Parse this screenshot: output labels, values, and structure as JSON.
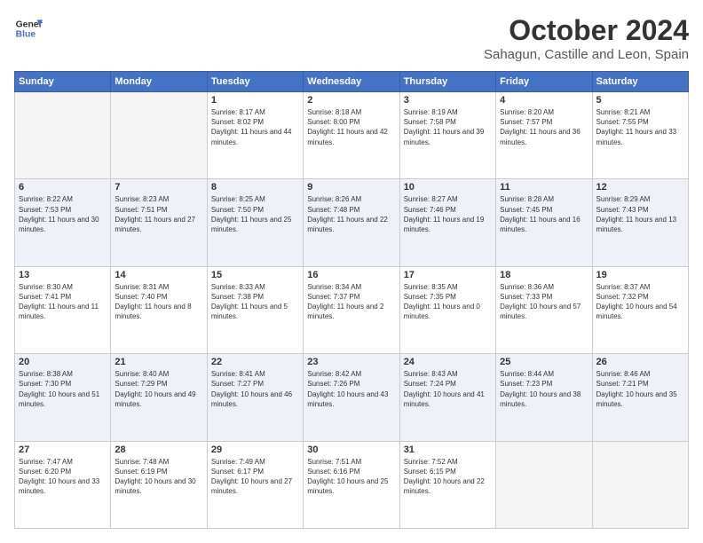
{
  "header": {
    "logo_line1": "General",
    "logo_line2": "Blue",
    "month": "October 2024",
    "location": "Sahagun, Castille and Leon, Spain"
  },
  "weekdays": [
    "Sunday",
    "Monday",
    "Tuesday",
    "Wednesday",
    "Thursday",
    "Friday",
    "Saturday"
  ],
  "weeks": [
    [
      {
        "day": "",
        "content": ""
      },
      {
        "day": "",
        "content": ""
      },
      {
        "day": "1",
        "content": "Sunrise: 8:17 AM\nSunset: 8:02 PM\nDaylight: 11 hours and 44 minutes."
      },
      {
        "day": "2",
        "content": "Sunrise: 8:18 AM\nSunset: 8:00 PM\nDaylight: 11 hours and 42 minutes."
      },
      {
        "day": "3",
        "content": "Sunrise: 8:19 AM\nSunset: 7:58 PM\nDaylight: 11 hours and 39 minutes."
      },
      {
        "day": "4",
        "content": "Sunrise: 8:20 AM\nSunset: 7:57 PM\nDaylight: 11 hours and 36 minutes."
      },
      {
        "day": "5",
        "content": "Sunrise: 8:21 AM\nSunset: 7:55 PM\nDaylight: 11 hours and 33 minutes."
      }
    ],
    [
      {
        "day": "6",
        "content": "Sunrise: 8:22 AM\nSunset: 7:53 PM\nDaylight: 11 hours and 30 minutes."
      },
      {
        "day": "7",
        "content": "Sunrise: 8:23 AM\nSunset: 7:51 PM\nDaylight: 11 hours and 27 minutes."
      },
      {
        "day": "8",
        "content": "Sunrise: 8:25 AM\nSunset: 7:50 PM\nDaylight: 11 hours and 25 minutes."
      },
      {
        "day": "9",
        "content": "Sunrise: 8:26 AM\nSunset: 7:48 PM\nDaylight: 11 hours and 22 minutes."
      },
      {
        "day": "10",
        "content": "Sunrise: 8:27 AM\nSunset: 7:46 PM\nDaylight: 11 hours and 19 minutes."
      },
      {
        "day": "11",
        "content": "Sunrise: 8:28 AM\nSunset: 7:45 PM\nDaylight: 11 hours and 16 minutes."
      },
      {
        "day": "12",
        "content": "Sunrise: 8:29 AM\nSunset: 7:43 PM\nDaylight: 11 hours and 13 minutes."
      }
    ],
    [
      {
        "day": "13",
        "content": "Sunrise: 8:30 AM\nSunset: 7:41 PM\nDaylight: 11 hours and 11 minutes."
      },
      {
        "day": "14",
        "content": "Sunrise: 8:31 AM\nSunset: 7:40 PM\nDaylight: 11 hours and 8 minutes."
      },
      {
        "day": "15",
        "content": "Sunrise: 8:33 AM\nSunset: 7:38 PM\nDaylight: 11 hours and 5 minutes."
      },
      {
        "day": "16",
        "content": "Sunrise: 8:34 AM\nSunset: 7:37 PM\nDaylight: 11 hours and 2 minutes."
      },
      {
        "day": "17",
        "content": "Sunrise: 8:35 AM\nSunset: 7:35 PM\nDaylight: 11 hours and 0 minutes."
      },
      {
        "day": "18",
        "content": "Sunrise: 8:36 AM\nSunset: 7:33 PM\nDaylight: 10 hours and 57 minutes."
      },
      {
        "day": "19",
        "content": "Sunrise: 8:37 AM\nSunset: 7:32 PM\nDaylight: 10 hours and 54 minutes."
      }
    ],
    [
      {
        "day": "20",
        "content": "Sunrise: 8:38 AM\nSunset: 7:30 PM\nDaylight: 10 hours and 51 minutes."
      },
      {
        "day": "21",
        "content": "Sunrise: 8:40 AM\nSunset: 7:29 PM\nDaylight: 10 hours and 49 minutes."
      },
      {
        "day": "22",
        "content": "Sunrise: 8:41 AM\nSunset: 7:27 PM\nDaylight: 10 hours and 46 minutes."
      },
      {
        "day": "23",
        "content": "Sunrise: 8:42 AM\nSunset: 7:26 PM\nDaylight: 10 hours and 43 minutes."
      },
      {
        "day": "24",
        "content": "Sunrise: 8:43 AM\nSunset: 7:24 PM\nDaylight: 10 hours and 41 minutes."
      },
      {
        "day": "25",
        "content": "Sunrise: 8:44 AM\nSunset: 7:23 PM\nDaylight: 10 hours and 38 minutes."
      },
      {
        "day": "26",
        "content": "Sunrise: 8:46 AM\nSunset: 7:21 PM\nDaylight: 10 hours and 35 minutes."
      }
    ],
    [
      {
        "day": "27",
        "content": "Sunrise: 7:47 AM\nSunset: 6:20 PM\nDaylight: 10 hours and 33 minutes."
      },
      {
        "day": "28",
        "content": "Sunrise: 7:48 AM\nSunset: 6:19 PM\nDaylight: 10 hours and 30 minutes."
      },
      {
        "day": "29",
        "content": "Sunrise: 7:49 AM\nSunset: 6:17 PM\nDaylight: 10 hours and 27 minutes."
      },
      {
        "day": "30",
        "content": "Sunrise: 7:51 AM\nSunset: 6:16 PM\nDaylight: 10 hours and 25 minutes."
      },
      {
        "day": "31",
        "content": "Sunrise: 7:52 AM\nSunset: 6:15 PM\nDaylight: 10 hours and 22 minutes."
      },
      {
        "day": "",
        "content": ""
      },
      {
        "day": "",
        "content": ""
      }
    ]
  ]
}
